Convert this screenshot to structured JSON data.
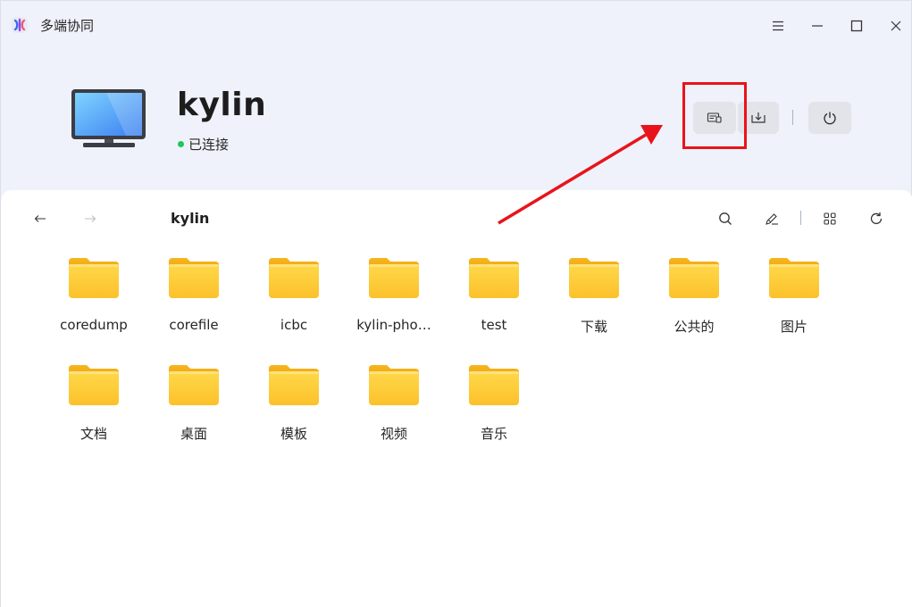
{
  "window": {
    "title": "多端协同",
    "controls": [
      "menu-icon",
      "minimize-icon",
      "maximize-icon",
      "close-icon"
    ]
  },
  "device": {
    "name": "kylin",
    "status": "已连接",
    "status_color": "#21c55d",
    "icon": "monitor-icon"
  },
  "header_actions": [
    {
      "name": "file-transfer-button",
      "icon": "file-transfer-icon"
    },
    {
      "name": "download-button",
      "icon": "download-icon"
    },
    {
      "name": "disconnect-button",
      "icon": "power-icon"
    }
  ],
  "browser": {
    "breadcrumb": "kylin",
    "toolbar": [
      "search-icon",
      "edit-icon",
      "grid-view-icon",
      "refresh-icon"
    ]
  },
  "folders": [
    {
      "label": "coredump"
    },
    {
      "label": "corefile"
    },
    {
      "label": "icbc"
    },
    {
      "label": "kylin-pho…"
    },
    {
      "label": "test"
    },
    {
      "label": "下载"
    },
    {
      "label": "公共的"
    },
    {
      "label": "图片"
    },
    {
      "label": "文档"
    },
    {
      "label": "桌面"
    },
    {
      "label": "模板"
    },
    {
      "label": "视频"
    },
    {
      "label": "音乐"
    }
  ],
  "colors": {
    "accent_red": "#e8141a",
    "folder_yellow": "#fcc12b",
    "background": "#eff2fb"
  }
}
